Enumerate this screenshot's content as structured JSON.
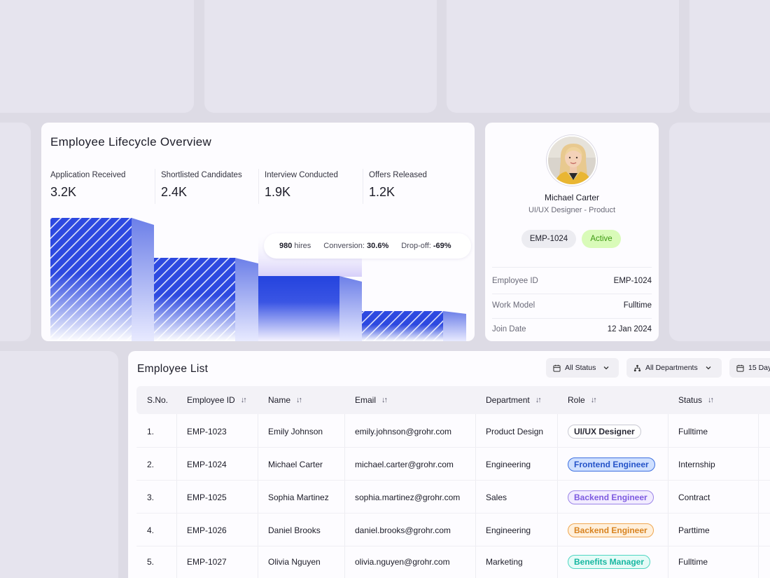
{
  "overview": {
    "title": "Employee Lifecycle Overview",
    "metrics": [
      {
        "label": "Application Received",
        "value": "3.2K"
      },
      {
        "label": "Shortlisted Candidates",
        "value": "2.4K"
      },
      {
        "label": "Interview Conducted",
        "value": "1.9K"
      },
      {
        "label": "Offers Released",
        "value": "1.2K"
      }
    ],
    "hires_value": "980",
    "hires_label": "hires",
    "conversion_label": "Conversion:",
    "conversion_value": "30.6%",
    "dropoff_label": "Drop-off:",
    "dropoff_value": "-69%",
    "colors": {
      "accent": "#2d49e0",
      "gradient_end": "#f4f2ff"
    }
  },
  "profile": {
    "name": "Michael Carter",
    "role": "UI/UX Designer - Product",
    "id_chip": "EMP-1024",
    "status_chip": "Active",
    "fields": [
      {
        "key": "Employee ID",
        "value": "EMP-1024"
      },
      {
        "key": "Work Model",
        "value": "Fulltime"
      },
      {
        "key": "Join Date",
        "value": "12 Jan 2024"
      }
    ]
  },
  "employee_list": {
    "title": "Employee List",
    "filters": [
      {
        "label": "All Status",
        "icon": "calendar-icon"
      },
      {
        "label": "All Departments",
        "icon": "org-chart-icon"
      },
      {
        "label": "15 Day",
        "icon": "calendar-icon"
      }
    ],
    "columns": [
      "S.No.",
      "Employee ID",
      "Name",
      "Email",
      "Department",
      "Role",
      "Status"
    ],
    "rows": [
      {
        "sno": "1.",
        "id": "EMP-1023",
        "name": "Emily Johnson",
        "email": "emily.johnson@grohr.com",
        "department": "Product Design",
        "role": "UI/UX Designer",
        "role_color": "gray",
        "status": "Fulltime"
      },
      {
        "sno": "2.",
        "id": "EMP-1024",
        "name": "Michael Carter",
        "email": "michael.carter@grohr.com",
        "department": "Engineering",
        "role": "Frontend Engineer",
        "role_color": "blue",
        "status": "Internship"
      },
      {
        "sno": "3.",
        "id": "EMP-1025",
        "name": "Sophia Martinez",
        "email": "sophia.martinez@grohr.com",
        "department": "Sales",
        "role": "Backend Engineer",
        "role_color": "purple",
        "status": "Contract"
      },
      {
        "sno": "4.",
        "id": "EMP-1026",
        "name": "Daniel Brooks",
        "email": "daniel.brooks@grohr.com",
        "department": "Engineering",
        "role": "Backend Engineer",
        "role_color": "orange",
        "status": "Parttime"
      },
      {
        "sno": "5.",
        "id": "EMP-1027",
        "name": "Olivia Nguyen",
        "email": "olivia.nguyen@grohr.com",
        "department": "Marketing",
        "role": "Benefits Manager",
        "role_color": "teal",
        "status": "Fulltime"
      }
    ]
  }
}
